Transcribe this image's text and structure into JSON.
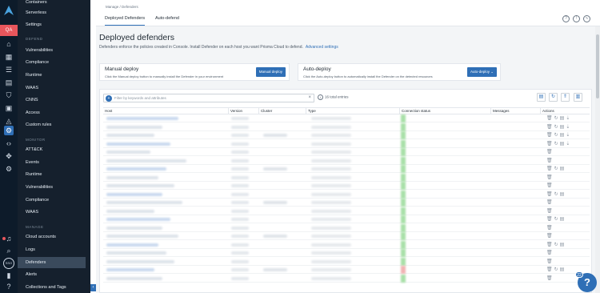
{
  "qa_label": "QA",
  "nav": {
    "top_items": [
      "Containers",
      "Serverless",
      "Settings"
    ],
    "defend_section": "DEFEND",
    "defend_items": [
      "Vulnerabilities",
      "Compliance",
      "Runtime",
      "WAAS",
      "CNNS",
      "Access",
      "Custom rules"
    ],
    "monitor_section": "MONITOR",
    "monitor_items": [
      "ATT&CK",
      "Events",
      "Runtime",
      "Vulnerabilities",
      "Compliance",
      "WAAS"
    ],
    "manage_section": "MANAGE",
    "manage_items": [
      "Cloud accounts",
      "Logs",
      "Defenders",
      "Alerts",
      "Collections and Tags"
    ],
    "active_item": "Defenders"
  },
  "breadcrumb": "Manage / Defenders",
  "tabs": [
    "Deployed Defenders",
    "Auto-defend"
  ],
  "page": {
    "title": "Deployed defenders",
    "description": "Defenders enforce the policies created in Console. Install Defender on each host you want Prisma Cloud to defend.",
    "advanced_link": "Advanced settings"
  },
  "manual_card": {
    "title": "Manual deploy",
    "description": "Click the Manual deploy button to manually install the Defender in your environment",
    "button": "Manual deploy"
  },
  "auto_card": {
    "title": "Auto-deploy",
    "description": "Click the Auto-deploy button to automatically install the Defender on the detected resources",
    "button": "Auto-deploy ⌄"
  },
  "filter": {
    "placeholder": "Filter by keywords and attributes",
    "entries": "16 total entries"
  },
  "table": {
    "columns": [
      "Host",
      "Version",
      "Cluster",
      "Type",
      "Connection status",
      "Messages",
      "Actions"
    ]
  },
  "help_badge": "22",
  "colors": {
    "accent": "#2f6fb6",
    "sidebar": "#15202d",
    "rail": "#0d1b2a",
    "qa": "#e8565c"
  }
}
